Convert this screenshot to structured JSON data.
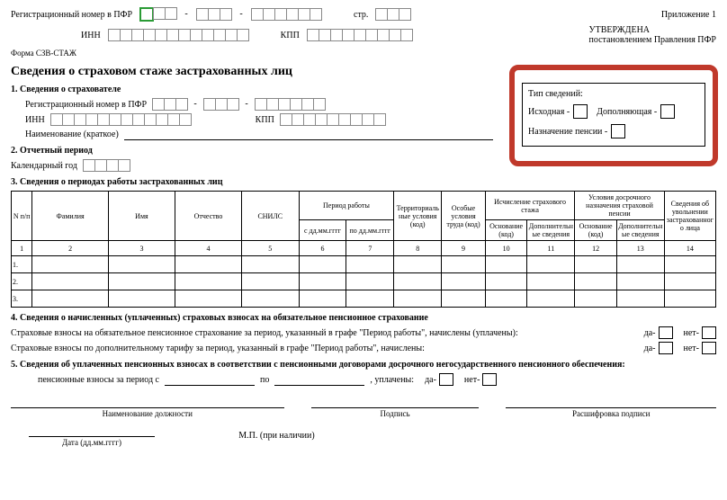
{
  "top": {
    "reg_label": "Регистрационный номер в ПФР",
    "page_label": "стр.",
    "inn_label": "ИНН",
    "kpp_label": "КПП",
    "appendix": "Приложение 1",
    "approved": "УТВЕРЖДЕНА",
    "approved_by": "постановлением Правления ПФР"
  },
  "form_code": "Форма СЗВ-СТАЖ",
  "title": "Сведения о страховом стаже застрахованных лиц",
  "s1": {
    "heading": "1. Сведения о страхователе",
    "reg_label": "Регистрационный номер в ПФР",
    "inn_label": "ИНН",
    "kpp_label": "КПП",
    "name_label": "Наименование (краткое)"
  },
  "callout": {
    "title": "Тип сведений:",
    "opt1": "Исходная -",
    "opt2": "Дополняющая -",
    "opt3": "Назначение пенсии -"
  },
  "s2": {
    "heading": "2. Отчетный период",
    "year_label": "Календарный год"
  },
  "s3": {
    "heading": "3. Сведения о периодах работы застрахованных лиц",
    "cols": {
      "n": "N п/п",
      "fam": "Фамилия",
      "name": "Имя",
      "patr": "Отчество",
      "snils": "СНИЛС",
      "period": "Период работы",
      "from": "с дд.мм.гггг",
      "to": "по дд.мм.гггг",
      "terr": "Территориальные условия (код)",
      "cond": "Особые условия труда (код)",
      "calc": "Исчисление страхового стажа",
      "early": "Условия досрочного назначения страховой пенсии",
      "base": "Основание (код)",
      "extra": "Дополнительные сведения",
      "fire": "Сведения об увольнении застрахованного лица"
    },
    "nums": [
      "1",
      "2",
      "3",
      "4",
      "5",
      "6",
      "7",
      "8",
      "9",
      "10",
      "11",
      "12",
      "13",
      "14"
    ],
    "rows": [
      "1.",
      "2.",
      "3."
    ]
  },
  "s4": {
    "heading": "4. Сведения о начисленных (уплаченных) страховых взносах на обязательное пенсионное страхование",
    "line1": "Страховые взносы на обязательное пенсионное страхование за период, указанный в графе \"Период работы\", начислены (уплачены):",
    "line2": "Страховые взносы по дополнительному тарифу за период, указанный в графе \"Период работы\", начислены:",
    "yes": "да-",
    "no": "нет-"
  },
  "s5": {
    "heading": "5. Сведения об уплаченных пенсионных взносах в соответствии с пенсионными договорами досрочного негосударственного пенсионного обеспечения:",
    "period_lbl": "пенсионные взносы за период с",
    "to": "по",
    "paid": ", уплачены:"
  },
  "sig": {
    "position": "Наименование должности",
    "sign": "Подпись",
    "decode": "Расшифровка подписи",
    "date": "Дата (дд.мм.гггг)",
    "stamp": "М.П. (при наличии)"
  }
}
